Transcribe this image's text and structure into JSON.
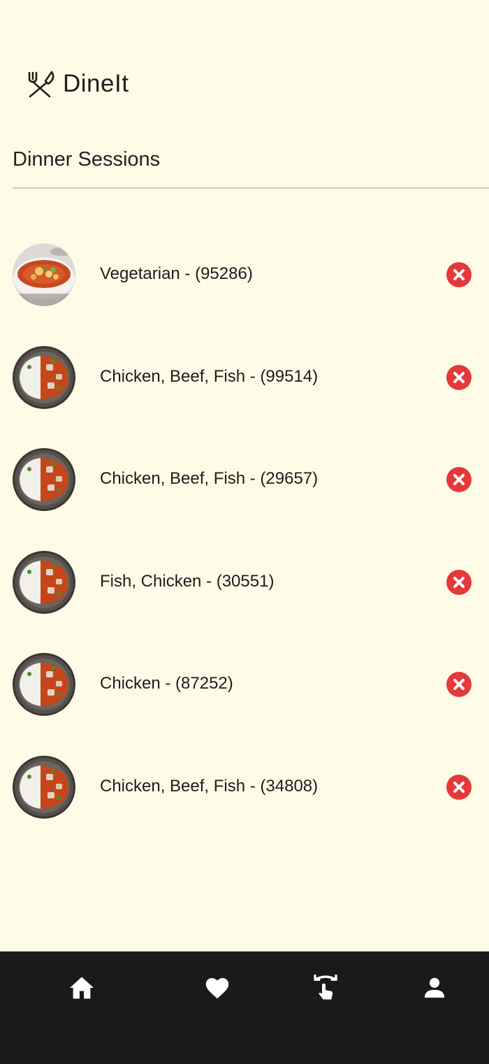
{
  "app": {
    "title": "DineIt",
    "logo_icon": "fork-knife-crossed-icon"
  },
  "page": {
    "title": "Dinner Sessions"
  },
  "sessions": [
    {
      "label": "Vegetarian - (95286)",
      "image": "vegetable-stew-bowl",
      "remove_icon": "close-circle-icon"
    },
    {
      "label": "Chicken, Beef, Fish - (99514)",
      "image": "curry-rice-plate",
      "remove_icon": "close-circle-icon"
    },
    {
      "label": "Chicken, Beef, Fish - (29657)",
      "image": "curry-rice-plate",
      "remove_icon": "close-circle-icon"
    },
    {
      "label": "Fish, Chicken - (30551)",
      "image": "curry-rice-plate",
      "remove_icon": "close-circle-icon"
    },
    {
      "label": "Chicken - (87252)",
      "image": "curry-rice-plate",
      "remove_icon": "close-circle-icon"
    },
    {
      "label": "Chicken, Beef, Fish - (34808)",
      "image": "curry-rice-plate",
      "remove_icon": "close-circle-icon"
    }
  ],
  "bottom_nav": {
    "items": [
      {
        "icon": "home-icon"
      },
      {
        "icon": "heart-icon"
      },
      {
        "icon": "swipe-gesture-icon"
      },
      {
        "icon": "person-icon"
      }
    ]
  },
  "colors": {
    "background": "#fefce6",
    "remove_accent": "#e5383b",
    "nav_background": "#1a1a1a",
    "nav_icon": "#ffffff"
  }
}
